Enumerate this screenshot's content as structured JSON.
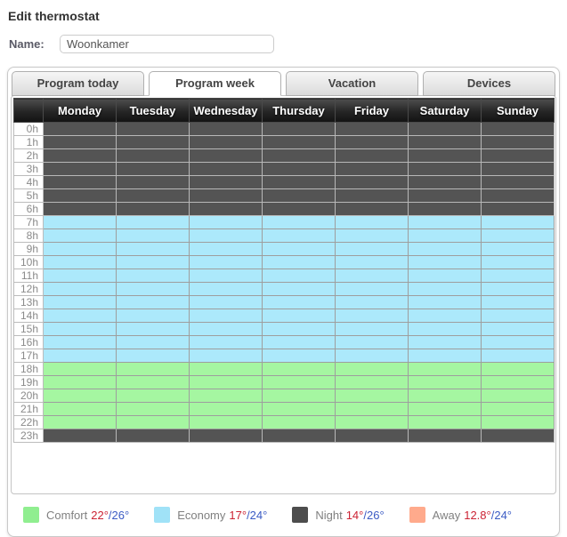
{
  "page_title": "Edit thermostat",
  "name_field": {
    "label": "Name:",
    "value": "Woonkamer"
  },
  "tabs": [
    {
      "label": "Program today",
      "active": false
    },
    {
      "label": "Program week",
      "active": true
    },
    {
      "label": "Vacation",
      "active": false
    },
    {
      "label": "Devices",
      "active": false
    }
  ],
  "schedule": {
    "days": [
      "Monday",
      "Tuesday",
      "Wednesday",
      "Thursday",
      "Friday",
      "Saturday",
      "Sunday"
    ],
    "hours": [
      "0h",
      "1h",
      "2h",
      "3h",
      "4h",
      "5h",
      "6h",
      "7h",
      "8h",
      "9h",
      "10h",
      "11h",
      "12h",
      "13h",
      "14h",
      "15h",
      "16h",
      "17h",
      "18h",
      "19h",
      "20h",
      "21h",
      "22h",
      "23h"
    ],
    "modes_by_hour": [
      "night",
      "night",
      "night",
      "night",
      "night",
      "night",
      "night",
      "economy",
      "economy",
      "economy",
      "economy",
      "economy",
      "economy",
      "economy",
      "economy",
      "economy",
      "economy",
      "economy",
      "comfort",
      "comfort",
      "comfort",
      "comfort",
      "comfort",
      "night"
    ],
    "same_for_all_days": true
  },
  "colors": {
    "comfort": "#a5f6a1",
    "economy": "#ace9fb",
    "night": "#545454",
    "away": "#ffab8a"
  },
  "legend": [
    {
      "mode": "comfort",
      "label": "Comfort",
      "temp_heat": "22°",
      "temp_cool": "/26°",
      "color": "#90ee90"
    },
    {
      "mode": "economy",
      "label": "Economy",
      "temp_heat": "17°",
      "temp_cool": "/24°",
      "color": "#a0e2f7"
    },
    {
      "mode": "night",
      "label": "Night",
      "temp_heat": "14°",
      "temp_cool": "/26°",
      "color": "#4d4d4d"
    },
    {
      "mode": "away",
      "label": "Away",
      "temp_heat": "12.8°",
      "temp_cool": "/24°",
      "color": "#ffaa8c"
    }
  ]
}
